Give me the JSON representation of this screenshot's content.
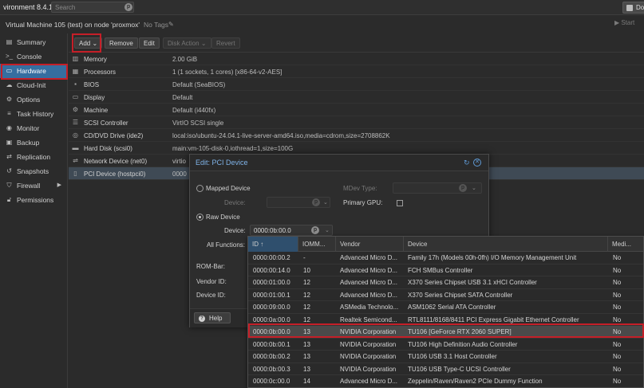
{
  "topbar": {
    "title": "vironment 8.4.1",
    "search_placeholder": "Search",
    "docs_label": "Doc"
  },
  "vm": {
    "title": "Virtual Machine 105 (test) on node 'proxmox'",
    "tags": "No Tags",
    "start_label": "Start"
  },
  "sidebar": {
    "items": [
      {
        "label": "Summary",
        "icon": "summary-icon"
      },
      {
        "label": "Console",
        "icon": "console-icon"
      },
      {
        "label": "Hardware",
        "icon": "monitor-icon",
        "active": true
      },
      {
        "label": "Cloud-Init",
        "icon": "cloud-icon"
      },
      {
        "label": "Options",
        "icon": "gear-icon"
      },
      {
        "label": "Task History",
        "icon": "list-icon"
      },
      {
        "label": "Monitor",
        "icon": "eye-icon"
      },
      {
        "label": "Backup",
        "icon": "floppy-icon"
      },
      {
        "label": "Replication",
        "icon": "retweet-icon"
      },
      {
        "label": "Snapshots",
        "icon": "history-icon"
      },
      {
        "label": "Firewall",
        "icon": "shield-icon"
      },
      {
        "label": "Permissions",
        "icon": "unlock-icon"
      }
    ]
  },
  "toolbar": {
    "add": "Add",
    "remove": "Remove",
    "edit": "Edit",
    "disk_action": "Disk Action",
    "revert": "Revert"
  },
  "hardware": [
    {
      "name": "Memory",
      "value": "2.00 GiB",
      "icon": "memory-icon"
    },
    {
      "name": "Processors",
      "value": "1 (1 sockets, 1 cores) [x86-64-v2-AES]",
      "icon": "cpu-icon"
    },
    {
      "name": "BIOS",
      "value": "Default (SeaBIOS)",
      "icon": "chip-icon"
    },
    {
      "name": "Display",
      "value": "Default",
      "icon": "desktop-icon"
    },
    {
      "name": "Machine",
      "value": "Default (i440fx)",
      "icon": "cogs-icon"
    },
    {
      "name": "SCSI Controller",
      "value": "VirtIO SCSI single",
      "icon": "database-icon"
    },
    {
      "name": "CD/DVD Drive (ide2)",
      "value": "local:iso/ubuntu-24.04.1-live-server-amd64.iso,media=cdrom,size=2708862K",
      "icon": "cd-icon"
    },
    {
      "name": "Hard Disk (scsi0)",
      "value": "main:vm-105-disk-0,iothread=1,size=100G",
      "icon": "hdd-icon"
    },
    {
      "name": "Network Device (net0)",
      "value": "virtio",
      "icon": "network-icon"
    },
    {
      "name": "PCI Device (hostpci0)",
      "value": "0000",
      "icon": "pci-icon"
    }
  ],
  "dialog": {
    "title": "Edit: PCI Device",
    "mapped_device": "Mapped Device",
    "device_label": "Device:",
    "raw_device": "Raw Device",
    "raw_device_value": "0000:0b:00.0",
    "all_functions": "All Functions:",
    "mdev_type": "MDev Type:",
    "primary_gpu": "Primary GPU:",
    "rom_bar": "ROM-Bar:",
    "vendor_id": "Vendor ID:",
    "device_id": "Device ID:",
    "help": "Help"
  },
  "device_grid": {
    "columns": [
      "ID ↑",
      "IOMM...",
      "Vendor",
      "Device",
      "Medi..."
    ],
    "rows": [
      {
        "id": "0000:00:00.2",
        "iommu": "-",
        "vendor": "Advanced Micro D...",
        "device": "Family 17h (Models 00h-0fh) I/O Memory Management Unit",
        "mdev": "No"
      },
      {
        "id": "0000:00:14.0",
        "iommu": "10",
        "vendor": "Advanced Micro D...",
        "device": "FCH SMBus Controller",
        "mdev": "No"
      },
      {
        "id": "0000:01:00.0",
        "iommu": "12",
        "vendor": "Advanced Micro D...",
        "device": "X370 Series Chipset USB 3.1 xHCI Controller",
        "mdev": "No"
      },
      {
        "id": "0000:01:00.1",
        "iommu": "12",
        "vendor": "Advanced Micro D...",
        "device": "X370 Series Chipset SATA Controller",
        "mdev": "No"
      },
      {
        "id": "0000:09:00.0",
        "iommu": "12",
        "vendor": "ASMedia Technolo...",
        "device": "ASM1062 Serial ATA Controller",
        "mdev": "No"
      },
      {
        "id": "0000:0a:00.0",
        "iommu": "12",
        "vendor": "Realtek Semicond...",
        "device": "RTL8111/8168/8411 PCI Express Gigabit Ethernet Controller",
        "mdev": "No"
      },
      {
        "id": "0000:0b:00.0",
        "iommu": "13",
        "vendor": "NVIDIA Corporation",
        "device": "TU106 [GeForce RTX 2060 SUPER]",
        "mdev": "No",
        "selected": true
      },
      {
        "id": "0000:0b:00.1",
        "iommu": "13",
        "vendor": "NVIDIA Corporation",
        "device": "TU106 High Definition Audio Controller",
        "mdev": "No"
      },
      {
        "id": "0000:0b:00.2",
        "iommu": "13",
        "vendor": "NVIDIA Corporation",
        "device": "TU106 USB 3.1 Host Controller",
        "mdev": "No"
      },
      {
        "id": "0000:0b:00.3",
        "iommu": "13",
        "vendor": "NVIDIA Corporation",
        "device": "TU106 USB Type-C UCSI Controller",
        "mdev": "No"
      },
      {
        "id": "0000:0c:00.0",
        "iommu": "14",
        "vendor": "Advanced Micro D...",
        "device": "Zeppelin/Raven/Raven2 PCIe Dummy Function",
        "mdev": "No"
      }
    ]
  },
  "colors": {
    "accent": "#356ea0",
    "highlight": "#c51f28",
    "title_blue": "#7fb2e6"
  }
}
